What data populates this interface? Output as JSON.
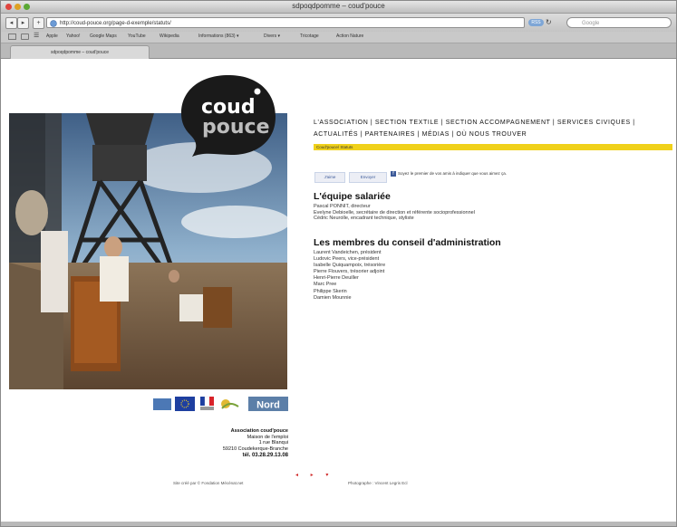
{
  "window": {
    "title": "sdpoqdpomme – coud'pouce"
  },
  "toolbar": {
    "url": "http://coud-pouce.org/page-d-exemple/statuts/",
    "rss_label": "RSS",
    "search_placeholder": "Google"
  },
  "bookmarks": [
    "Apple",
    "Yahoo!",
    "Google Maps",
    "YouTube",
    "Wikipedia",
    "Informations (863) ▾",
    "Divers ▾",
    "Tricotage",
    "Action Nature"
  ],
  "tab": {
    "label": "sdpoqdpomme – coud'pouce"
  },
  "logo": {
    "line1": "coud",
    "line2": "pouce",
    "brand_color": "#1a1a1a"
  },
  "nav": {
    "items": [
      "L'ASSOCIATION",
      "SECTION TEXTILE",
      "SECTION ACCOMPAGNEMENT",
      "SERVICES CIVIQUES",
      "ACTUALITÉS",
      "PARTENAIRES",
      "MÉDIAS",
      "OÙ NOUS TROUVER"
    ],
    "separator": "|"
  },
  "breadcrumb": {
    "text": "Coud'pouce/ Statuts",
    "color": "#f0d11a"
  },
  "facebook": {
    "like_label": "J'aime",
    "share_label": "Envoyer",
    "prompt": "Soyez le premier de vos amis à indiquer que vous aimez ça."
  },
  "staff": {
    "heading": "L'équipe salariée",
    "members": [
      "Pascal PONNIT, directeur",
      "Evelyne Debioelle, secrétaire de direction et référente socioprofessionnel",
      "Cédric Neurolle, encadrant technique, styliste"
    ]
  },
  "board": {
    "heading": "Les membres du conseil d'administration",
    "members": [
      "Laurent Vandeichen, président",
      "Ludovic Peers, vice-président",
      "Isabelle Quiquampoix, trésorière",
      "Pierre Flouvers, trésorier adjoint",
      "Henri-Pierre Deuiller",
      "Marc Pree",
      "Philippe Skerin",
      "Damien Mounnie"
    ]
  },
  "partners": {
    "badge_text": "Nord",
    "eu_color": "#1e3fa0",
    "nord_color": "#5c7fa8"
  },
  "address": {
    "lines": [
      "Association coud'pouce",
      "Maison de l'emploi",
      "1 rue Blanqui",
      "59210 Coudekerque-Branche"
    ],
    "phone": "tél. 03.28.29.13.08"
  },
  "footer": {
    "left": "Site créé par © Fondation Mécénat.net",
    "right": "Photographe : Vincent Legris Ecl",
    "arrows": "◂ ▸ ▾"
  }
}
